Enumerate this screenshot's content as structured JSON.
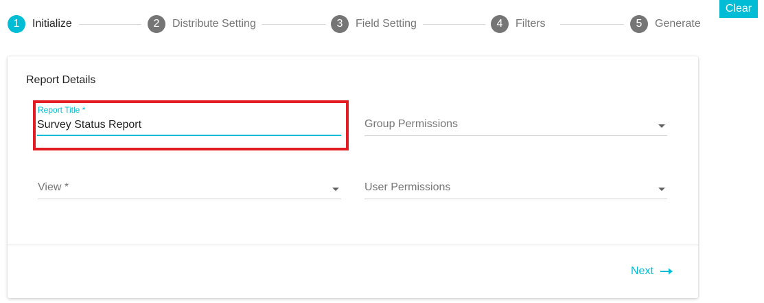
{
  "stepper": {
    "steps": [
      {
        "number": "1",
        "label": "Initialize",
        "state": "active"
      },
      {
        "number": "2",
        "label": "Distribute Setting",
        "state": "inactive"
      },
      {
        "number": "3",
        "label": "Field Setting",
        "state": "inactive"
      },
      {
        "number": "4",
        "label": "Filters",
        "state": "inactive"
      },
      {
        "number": "5",
        "label": "Generate",
        "state": "inactive"
      }
    ]
  },
  "actions": {
    "clear_label": "Clear",
    "next_label": "Next",
    "next_icon": "arrow-right-icon"
  },
  "form": {
    "section_title": "Report Details",
    "report_title": {
      "label": "Report Title *",
      "value": "Survey Status Report"
    },
    "group_permissions": {
      "placeholder": "Group Permissions",
      "icon": "dropdown-caret-icon"
    },
    "view": {
      "placeholder": "View *",
      "icon": "dropdown-caret-icon"
    },
    "user_permissions": {
      "placeholder": "User Permissions",
      "icon": "dropdown-caret-icon"
    }
  },
  "colors": {
    "accent": "#00bcd4",
    "step_inactive": "#757575",
    "highlight": "#e31b23"
  }
}
